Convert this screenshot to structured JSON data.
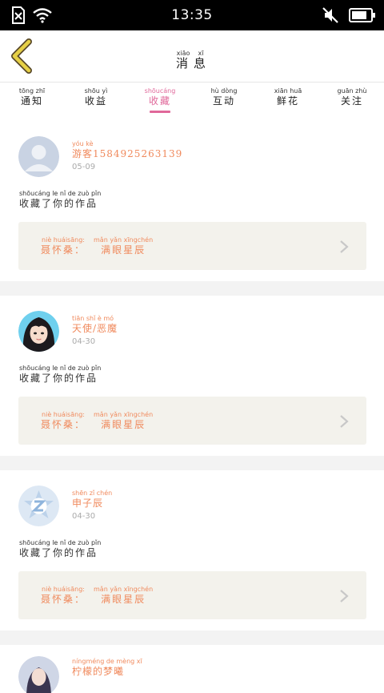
{
  "status": {
    "time": "13:35"
  },
  "header": {
    "title": [
      {
        "py": "xiāo",
        "hz": "消"
      },
      {
        "py": "xī",
        "hz": "息"
      }
    ]
  },
  "tabs": [
    {
      "py": "tōng zhī",
      "hz": "通知"
    },
    {
      "py": "shōu yì",
      "hz": "收益"
    },
    {
      "py": "shōucáng",
      "hz": "收藏",
      "active": true
    },
    {
      "py": "hù dòng",
      "hz": "互动"
    },
    {
      "py": "xiān huā",
      "hz": "鲜花"
    },
    {
      "py": "guān zhù",
      "hz": "关注"
    }
  ],
  "action": {
    "py": "shōucáng le  nǐ  de  zuò pǐn",
    "hz": "收藏了你的作品"
  },
  "work": {
    "label_py": "niè huáisāng:",
    "label_hz": "聂怀桑：",
    "title_py": "mǎn yǎn xīngchén",
    "title_hz": "满眼星辰"
  },
  "messages": [
    {
      "user_py": "yóu  kè",
      "user_hz": "游客15849252631​39",
      "date": "05-09",
      "avatar": "default-avatar"
    },
    {
      "user_py": "tiān shǐ  è  mó",
      "user_hz": "天使/恶魔",
      "date": "04-30",
      "avatar": "girl-avatar"
    },
    {
      "user_py": "shēn zǐ chén",
      "user_hz": "申子辰",
      "date": "04-30",
      "avatar": "z-logo-avatar"
    }
  ],
  "partial": {
    "user_py": "níngméng de mèng xī",
    "user_hz": "柠檬的梦曦"
  },
  "colors": {
    "accent": "#e0689a",
    "orange": "#f08a5d",
    "card_bg": "#f3f2ec"
  }
}
